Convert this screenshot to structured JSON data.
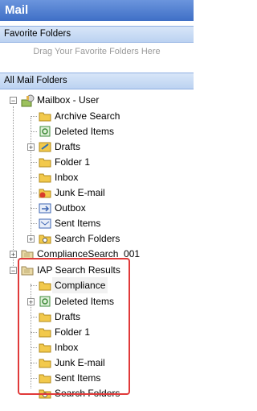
{
  "title": "Mail",
  "favorite_folders": {
    "header": "Favorite Folders",
    "hint": "Drag Your Favorite Folders Here"
  },
  "all_mail_folders": {
    "header": "All Mail Folders"
  },
  "tree": {
    "mailbox": {
      "label": "Mailbox - User",
      "children": [
        "Archive Search",
        "Deleted Items",
        "Drafts",
        "Folder 1",
        "Inbox",
        "Junk E-mail",
        "Outbox",
        "Sent Items",
        "Search Folders"
      ]
    },
    "compliance_search": {
      "label": "ComplianceSearch_001"
    },
    "iap": {
      "label": "IAP Search Results",
      "children": [
        "Compliance",
        "Deleted Items",
        "Drafts",
        "Folder 1",
        "Inbox",
        "Junk E-mail",
        "Sent Items",
        "Search Folders"
      ]
    }
  },
  "colors": {
    "title_bar": "#4a78cc",
    "highlight_border": "#e03a3a",
    "folder": "#f2c94c"
  }
}
